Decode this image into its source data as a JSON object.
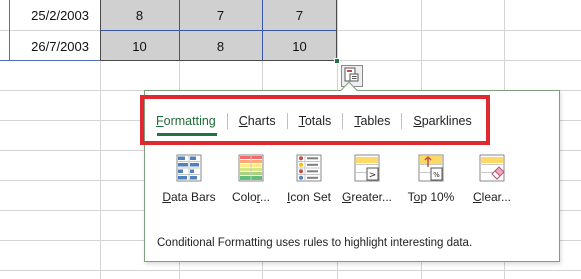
{
  "sheet": {
    "rows": [
      {
        "date": "25/2/2003",
        "values": [
          "8",
          "7",
          "7"
        ]
      },
      {
        "date": "26/7/2003",
        "values": [
          "10",
          "8",
          "10"
        ]
      }
    ]
  },
  "quick_analysis": {
    "button_icon": "quick-analysis-icon",
    "tabs": [
      {
        "pre": "",
        "key": "F",
        "post": "ormatting",
        "active": true
      },
      {
        "pre": "",
        "key": "C",
        "post": "harts",
        "active": false
      },
      {
        "pre": "",
        "key": "T",
        "post": "otals",
        "active": false
      },
      {
        "pre": "",
        "key": "T",
        "post": "ables",
        "active": false
      },
      {
        "pre": "",
        "key": "S",
        "post": "parklines",
        "active": false
      }
    ],
    "items": [
      {
        "pre": "",
        "key": "D",
        "post": "ata Bars",
        "icon": "data-bars-icon"
      },
      {
        "pre": "Colo",
        "key": "r",
        "post": "...",
        "icon": "color-scale-icon"
      },
      {
        "pre": "",
        "key": "I",
        "post": "con Set",
        "icon": "icon-set-icon"
      },
      {
        "pre": "",
        "key": "G",
        "post": "reater...",
        "icon": "greater-than-icon"
      },
      {
        "pre": "T",
        "key": "o",
        "post": "p 10%",
        "icon": "top-10-icon"
      },
      {
        "pre": "",
        "key": "C",
        "post": "lear...",
        "icon": "clear-format-icon"
      }
    ],
    "description": "Conditional Formatting uses rules to highlight interesting data."
  },
  "colors": {
    "accent": "#217346",
    "highlight": "#e0282f",
    "selection_fill": "#d0d0d0"
  }
}
